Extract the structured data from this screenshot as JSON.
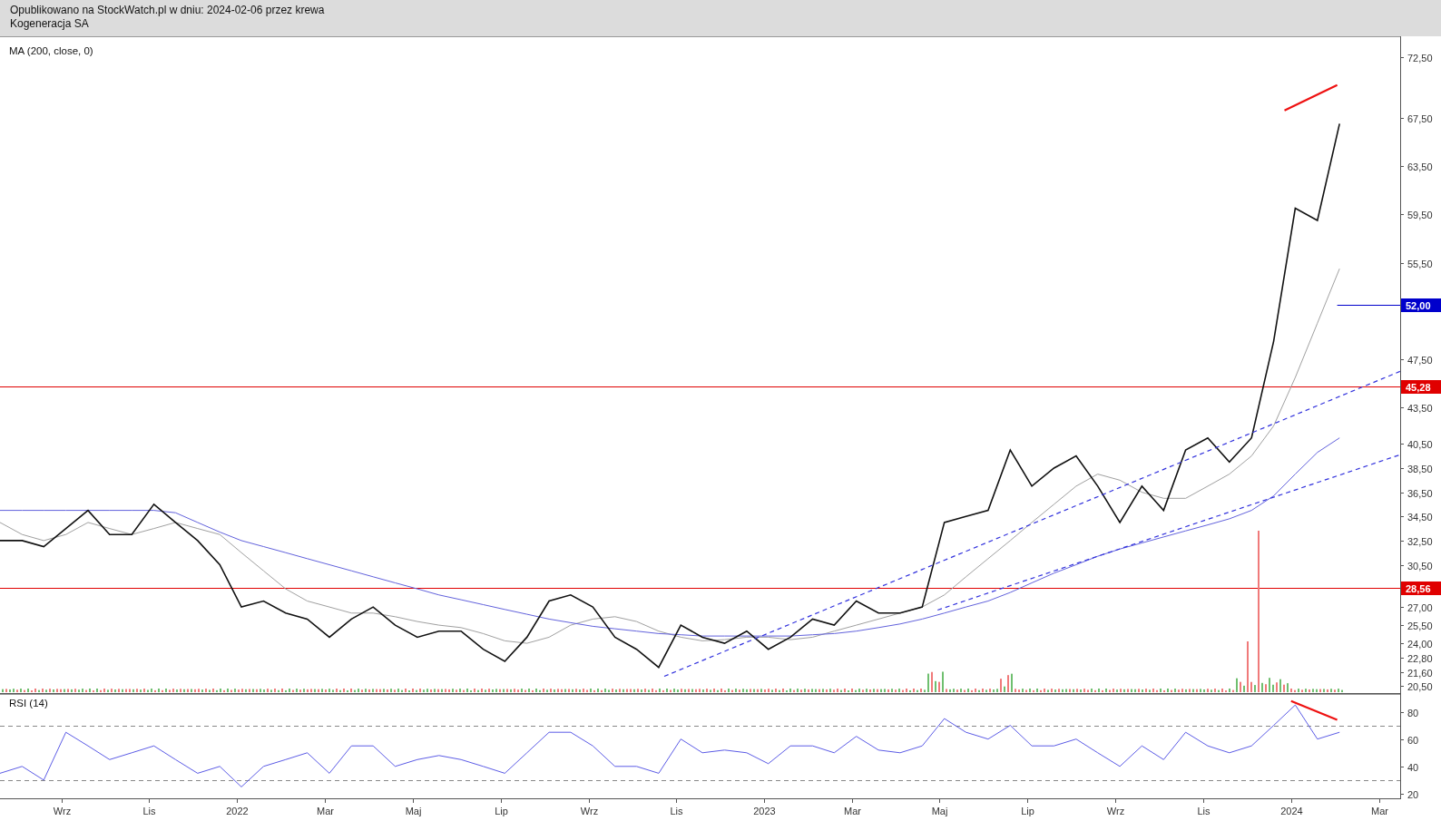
{
  "header": {
    "published_note": "Opublikowano na StockWatch.pl w dniu: 2024-02-06 przez krewa",
    "company": "Kogeneracja SA"
  },
  "price_pane": {
    "chart_data": {
      "type": "line",
      "title": "MA (200, close, 0)",
      "x": [
        2021.55,
        2021.592,
        2021.633,
        2021.675,
        2021.717,
        2021.758,
        2021.8,
        2021.842,
        2021.883,
        2021.925,
        2021.967,
        2022.008,
        2022.05,
        2022.092,
        2022.133,
        2022.175,
        2022.217,
        2022.258,
        2022.3,
        2022.342,
        2022.383,
        2022.425,
        2022.467,
        2022.508,
        2022.55,
        2022.592,
        2022.633,
        2022.675,
        2022.717,
        2022.758,
        2022.8,
        2022.842,
        2022.883,
        2022.925,
        2022.967,
        2023.008,
        2023.05,
        2023.092,
        2023.133,
        2023.175,
        2023.217,
        2023.258,
        2023.3,
        2023.342,
        2023.383,
        2023.425,
        2023.467,
        2023.508,
        2023.55,
        2023.592,
        2023.633,
        2023.675,
        2023.717,
        2023.758,
        2023.8,
        2023.842,
        2023.883,
        2023.925,
        2023.967,
        2024.008,
        2024.05,
        2024.092
      ],
      "xlim": [
        2021.55,
        2024.207
      ],
      "ylim": [
        19.8,
        74.24
      ],
      "yticks": [
        {
          "value": 72.5,
          "label": "72,50"
        },
        {
          "value": 67.5,
          "label": "67,50"
        },
        {
          "value": 63.5,
          "label": "63,50"
        },
        {
          "value": 59.5,
          "label": "59,50"
        },
        {
          "value": 55.5,
          "label": "55,50"
        },
        {
          "value": 47.5,
          "label": "47,50"
        },
        {
          "value": 43.5,
          "label": "43,50"
        },
        {
          "value": 40.5,
          "label": "40,50"
        },
        {
          "value": 38.5,
          "label": "38,50"
        },
        {
          "value": 36.5,
          "label": "36,50"
        },
        {
          "value": 34.5,
          "label": "34,50"
        },
        {
          "value": 32.5,
          "label": "32,50"
        },
        {
          "value": 30.5,
          "label": "30,50"
        },
        {
          "value": 27,
          "label": "27,00"
        },
        {
          "value": 25.5,
          "label": "25,50"
        },
        {
          "value": 24,
          "label": "24,00"
        },
        {
          "value": 22.8,
          "label": "22,80"
        },
        {
          "value": 21.6,
          "label": "21,60"
        },
        {
          "value": 20.5,
          "label": "20,50"
        }
      ],
      "series": [
        {
          "color": "#a0a0a0",
          "values": [
            34,
            33,
            32.5,
            33,
            34,
            33.5,
            33,
            33.5,
            34,
            33.5,
            33,
            31.5,
            30,
            28.5,
            27.5,
            27,
            26.5,
            26.5,
            26.2,
            25.8,
            25.5,
            25.3,
            24.8,
            24.2,
            24,
            24.5,
            25.5,
            26,
            26.2,
            25.8,
            25,
            24.5,
            24.2,
            24.3,
            24.5,
            24.5,
            24.3,
            24.5,
            25,
            25.5,
            26,
            26.5,
            27,
            28,
            29.5,
            31,
            32.5,
            34,
            35.5,
            37,
            38,
            37.5,
            36.5,
            36,
            36,
            37,
            38,
            39.5,
            42,
            46,
            50.5,
            55
          ]
        },
        {
          "color": "#6262dc",
          "values": [
            35,
            35,
            35,
            35,
            35,
            35,
            35,
            35,
            34.8,
            34,
            33.2,
            32.5,
            32,
            31.5,
            31,
            30.5,
            30,
            29.5,
            29,
            28.5,
            28,
            27.6,
            27.2,
            26.8,
            26.4,
            26,
            25.7,
            25.4,
            25.2,
            25,
            24.8,
            24.7,
            24.6,
            24.6,
            24.6,
            24.6,
            24.6,
            24.7,
            24.8,
            25,
            25.3,
            25.6,
            26,
            26.5,
            27,
            27.5,
            28.2,
            29,
            29.8,
            30.5,
            31.2,
            31.8,
            32.3,
            32.8,
            33.3,
            33.8,
            34.3,
            35,
            36.2,
            38,
            39.8,
            41
          ]
        },
        {
          "color": "#111111",
          "values": [
            32.5,
            32.5,
            32,
            33.5,
            35,
            33,
            33,
            35.5,
            34,
            32.5,
            30.5,
            27,
            27.5,
            26.5,
            26,
            24.5,
            26,
            27,
            25.5,
            24.5,
            25,
            25,
            23.5,
            22.5,
            24.5,
            27.5,
            28,
            27,
            24.5,
            23.5,
            22,
            25.5,
            24.5,
            24,
            25,
            23.5,
            24.5,
            26,
            25.5,
            27.5,
            26.5,
            26.5,
            27,
            34,
            34.5,
            35,
            40,
            37,
            38.5,
            39.5,
            37,
            34,
            37,
            35,
            40,
            41,
            39,
            41,
            49,
            60,
            59,
            67
          ]
        }
      ],
      "ref_lines": [
        {
          "axis": "y",
          "value": 52,
          "label": "52,00",
          "color": "#0000cc"
        },
        {
          "axis": "y",
          "value": 45.28,
          "label": "45,28",
          "color": "#e00000"
        },
        {
          "axis": "y",
          "value": 28.56,
          "label": "28,56",
          "color": "#e00000"
        }
      ]
    }
  },
  "rsi_pane": {
    "chart_data": {
      "type": "line",
      "title": "RSI (14)",
      "x": [
        2021.55,
        2021.592,
        2021.633,
        2021.675,
        2021.717,
        2021.758,
        2021.8,
        2021.842,
        2021.883,
        2021.925,
        2021.967,
        2022.008,
        2022.05,
        2022.092,
        2022.133,
        2022.175,
        2022.217,
        2022.258,
        2022.3,
        2022.342,
        2022.383,
        2022.425,
        2022.467,
        2022.508,
        2022.55,
        2022.592,
        2022.633,
        2022.675,
        2022.717,
        2022.758,
        2022.8,
        2022.842,
        2022.883,
        2022.925,
        2022.967,
        2023.008,
        2023.05,
        2023.092,
        2023.133,
        2023.175,
        2023.217,
        2023.258,
        2023.3,
        2023.342,
        2023.383,
        2023.425,
        2023.467,
        2023.508,
        2023.55,
        2023.592,
        2023.633,
        2023.675,
        2023.717,
        2023.758,
        2023.8,
        2023.842,
        2023.883,
        2023.925,
        2023.967,
        2024.008,
        2024.05,
        2024.092
      ],
      "xlim": [
        2021.55,
        2024.207
      ],
      "ylim": [
        16,
        93
      ],
      "yticks": [
        80,
        60,
        40,
        20
      ],
      "xticks": [
        {
          "value": 2021.667,
          "label": "Wrz"
        },
        {
          "value": 2021.833,
          "label": "Lis"
        },
        {
          "value": 2022,
          "label": "2022"
        },
        {
          "value": 2022.167,
          "label": "Mar"
        },
        {
          "value": 2022.333,
          "label": "Maj"
        },
        {
          "value": 2022.5,
          "label": "Lip"
        },
        {
          "value": 2022.667,
          "label": "Wrz"
        },
        {
          "value": 2022.833,
          "label": "Lis"
        },
        {
          "value": 2023,
          "label": "2023"
        },
        {
          "value": 2023.167,
          "label": "Mar"
        },
        {
          "value": 2023.333,
          "label": "Maj"
        },
        {
          "value": 2023.5,
          "label": "Lip"
        },
        {
          "value": 2023.667,
          "label": "Wrz"
        },
        {
          "value": 2023.833,
          "label": "Lis"
        },
        {
          "value": 2024,
          "label": "2024"
        },
        {
          "value": 2024.167,
          "label": "Mar"
        }
      ],
      "series": [
        {
          "color": "#5c5ce6",
          "values": [
            35,
            40,
            30,
            65,
            55,
            45,
            50,
            55,
            45,
            35,
            40,
            25,
            40,
            45,
            50,
            35,
            55,
            55,
            40,
            45,
            48,
            45,
            40,
            35,
            50,
            65,
            65,
            55,
            40,
            40,
            35,
            60,
            50,
            52,
            50,
            42,
            55,
            55,
            50,
            62,
            52,
            50,
            55,
            75,
            65,
            60,
            70,
            55,
            55,
            60,
            50,
            40,
            55,
            45,
            65,
            55,
            50,
            55,
            70,
            85,
            60,
            65
          ]
        }
      ],
      "ref_lines": [
        {
          "axis": "y",
          "value": 70
        },
        {
          "axis": "y",
          "value": 30
        }
      ]
    }
  }
}
